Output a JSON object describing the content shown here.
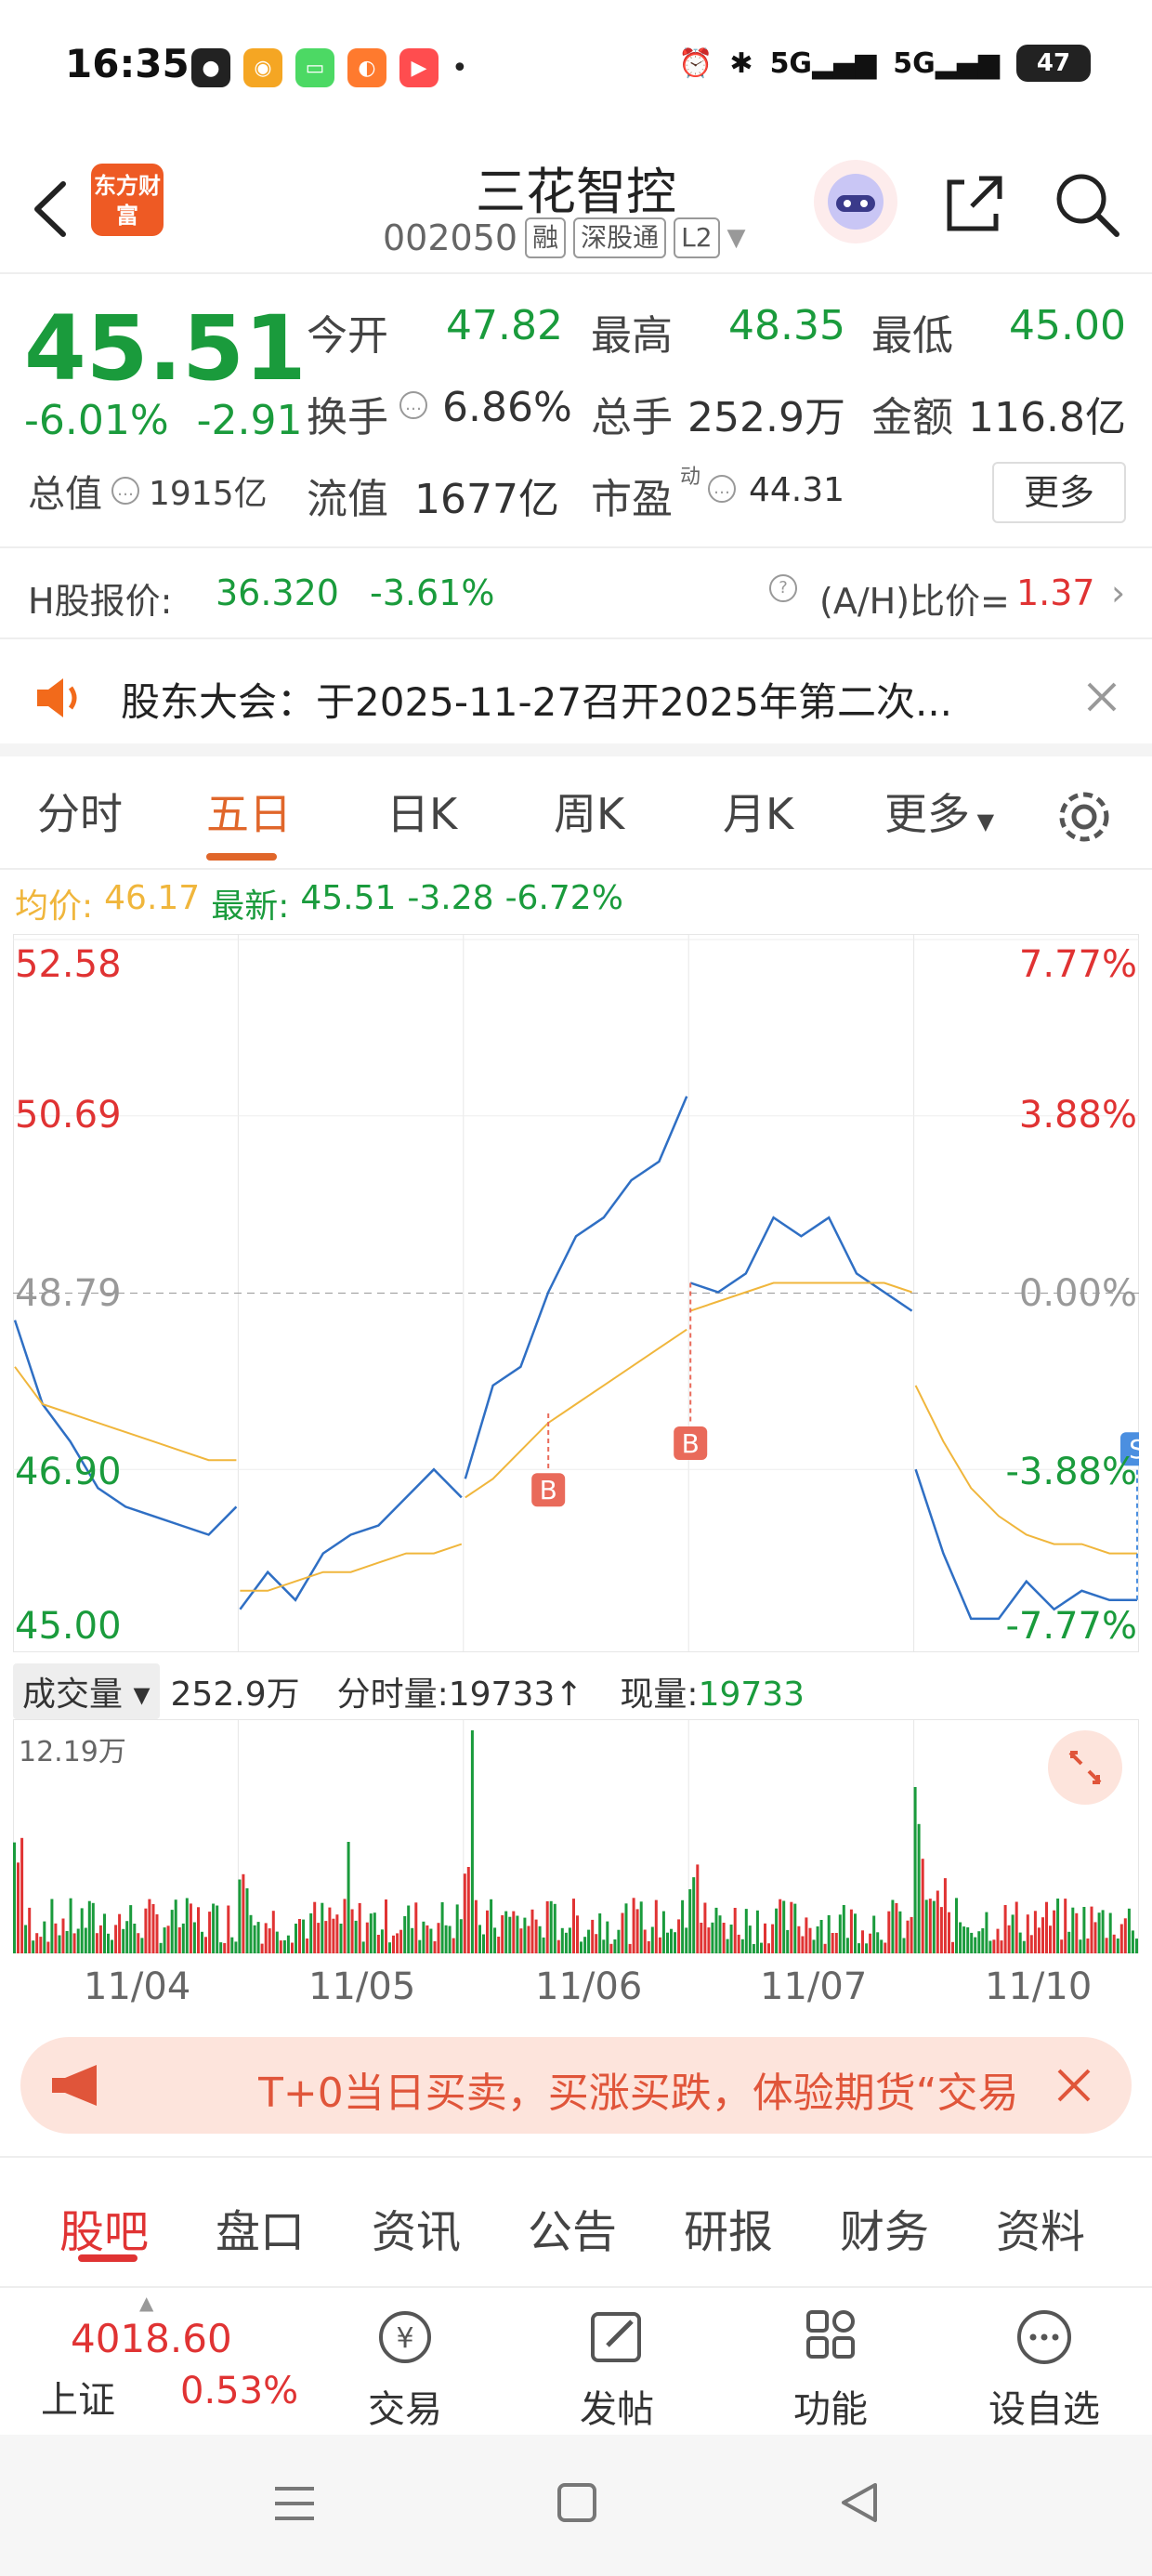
{
  "status_bar": {
    "time": "16:35",
    "battery": "47",
    "network": "5G"
  },
  "header": {
    "logo_text": "东方财富",
    "stock_name": "三花智控",
    "stock_code": "002050",
    "tags": [
      "融",
      "深股通",
      "L2"
    ]
  },
  "quote": {
    "price": "45.51",
    "change_pct": "-6.01%",
    "change_abs": "-2.91",
    "open_label": "今开",
    "open": "47.82",
    "high_label": "最高",
    "high": "48.35",
    "low_label": "最低",
    "low": "45.00",
    "turnover_label": "换手",
    "turnover": "6.86%",
    "volume_label": "总手",
    "volume": "252.9万",
    "amount_label": "金额",
    "amount": "116.8亿",
    "mktcap_label": "总值",
    "mktcap": "1915亿",
    "float_label": "流值",
    "float": "1677亿",
    "pe_label": "市盈",
    "pe_sup": "动",
    "pe": "44.31",
    "more_label": "更多"
  },
  "hshare": {
    "label": "H股报价:",
    "price": "36.320",
    "pct": "-3.61%",
    "ah_label": "(A/H)比价=",
    "ah_value": "1.37"
  },
  "notice": {
    "text": "股东大会：于2025-11-27召开2025年第二次..."
  },
  "chart_tabs": [
    {
      "label": "分时"
    },
    {
      "label": "五日"
    },
    {
      "label": "日K"
    },
    {
      "label": "周K"
    },
    {
      "label": "月K"
    },
    {
      "label": "更多"
    }
  ],
  "avg_row": {
    "avg_label": "均价:",
    "avg_value": "46.17",
    "latest_label": "最新:",
    "latest_value": "45.51",
    "chg": "-3.28",
    "pct": "-6.72%"
  },
  "chart_data": {
    "type": "line",
    "y_left_ticks": [
      "52.58",
      "50.69",
      "48.79",
      "46.90",
      "45.00"
    ],
    "y_right_ticks": [
      "7.77%",
      "3.88%",
      "0.00%",
      "-3.88%",
      "-7.77%"
    ],
    "ylim": [
      45.0,
      52.58
    ],
    "reference": 48.79,
    "days": [
      "11/04",
      "11/05",
      "11/06",
      "11/07",
      "11/10"
    ],
    "series": [
      {
        "name": "",
        "values": [
          [
            48.5,
            47.6,
            47.2,
            46.7,
            46.5,
            46.4,
            46.3,
            46.2,
            46.5
          ],
          [
            45.4,
            45.8,
            45.5,
            46.0,
            46.2,
            46.3,
            46.6,
            46.9,
            46.6
          ],
          [
            46.8,
            47.8,
            48.0,
            48.8,
            49.4,
            49.6,
            50.0,
            50.2,
            50.9
          ],
          [
            48.9,
            48.8,
            49.0,
            49.6,
            49.4,
            49.6,
            49.0,
            48.8,
            48.6
          ],
          [
            46.9,
            46.0,
            45.3,
            45.3,
            45.7,
            45.4,
            45.6,
            45.5,
            45.5
          ]
        ]
      },
      {
        "name": "",
        "values": [
          [
            48.0,
            47.6,
            47.5,
            47.4,
            47.3,
            47.2,
            47.1,
            47.0,
            47.0
          ],
          [
            45.6,
            45.6,
            45.7,
            45.8,
            45.8,
            45.9,
            46.0,
            46.0,
            46.1
          ],
          [
            46.6,
            46.8,
            47.1,
            47.4,
            47.6,
            47.8,
            48.0,
            48.2,
            48.4
          ],
          [
            48.6,
            48.7,
            48.8,
            48.9,
            48.9,
            48.9,
            48.9,
            48.9,
            48.8
          ],
          [
            47.8,
            47.2,
            46.7,
            46.4,
            46.2,
            46.1,
            46.1,
            46.0,
            46.0
          ]
        ]
      }
    ],
    "markers": [
      "B",
      "B",
      "S"
    ],
    "volume_max_label": "12.19万"
  },
  "volume_row": {
    "selector": "成交量",
    "total": "252.9万",
    "tick_label": "分时量:",
    "tick_value": "19733↑",
    "now_label": "现量:",
    "now_value": "19733"
  },
  "banner": {
    "text": "T+0当日买卖，买涨买跌，体验期货“交易"
  },
  "sub_tabs": [
    {
      "label": "股吧"
    },
    {
      "label": "盘口"
    },
    {
      "label": "资讯"
    },
    {
      "label": "公告"
    },
    {
      "label": "研报"
    },
    {
      "label": "财务"
    },
    {
      "label": "资料"
    }
  ],
  "bottom_nav": {
    "index_value": "4018.60",
    "index_name": "上证",
    "index_pct": "0.53%",
    "items": [
      {
        "label": "交易"
      },
      {
        "label": "发帖"
      },
      {
        "label": "功能"
      },
      {
        "label": "设自选"
      }
    ]
  },
  "colors": {
    "up": "#e03333",
    "down": "#1a9b3c",
    "accent": "#e0662a",
    "price_line": "#2f6fc4",
    "avg_line": "#f0b63c"
  }
}
